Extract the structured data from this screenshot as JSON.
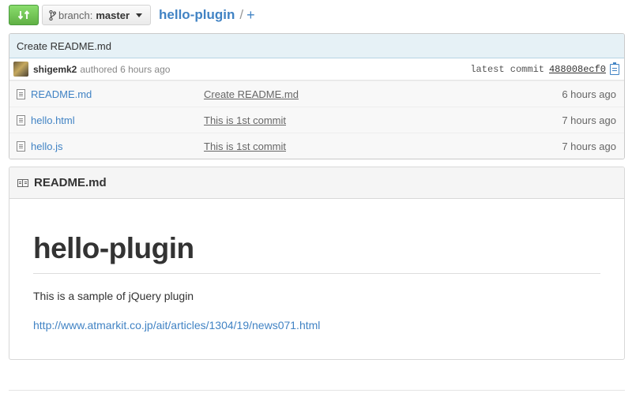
{
  "topbar": {
    "compare_icon": "compare-arrows-icon",
    "branch_prefix": "branch:",
    "branch_name": "master",
    "repo_name": "hello-plugin",
    "separator": "/",
    "new_file": "+"
  },
  "commit": {
    "message": "Create README.md",
    "author": "shigemk2",
    "authored": "authored 6 hours ago",
    "latest_label": "latest commit",
    "sha": "488008ecf0"
  },
  "files": [
    {
      "name": "README.md",
      "message": "Create README.md",
      "age": "6 hours ago"
    },
    {
      "name": "hello.html",
      "message": "This is 1st commit",
      "age": "7 hours ago"
    },
    {
      "name": "hello.js",
      "message": "This is 1st commit",
      "age": "7 hours ago"
    }
  ],
  "readme": {
    "title": "README.md",
    "heading": "hello-plugin",
    "paragraph": "This is a sample of jQuery plugin",
    "link": "http://www.atmarkit.co.jp/ait/articles/1304/19/news071.html"
  },
  "colors": {
    "accent": "#4183c4",
    "compare_green": "#60b044",
    "commit_bg": "#e6f1f6"
  }
}
